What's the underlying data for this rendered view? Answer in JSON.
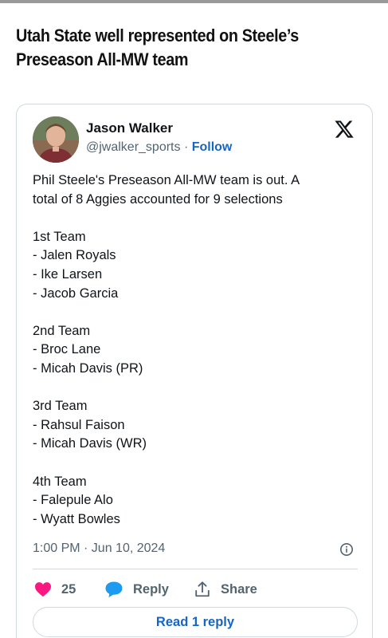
{
  "article": {
    "headline_line1": "Utah State well represented on Steele’s",
    "headline_line2": "Preseason All-MW team"
  },
  "tweet": {
    "author_name": "Jason Walker",
    "author_handle": "@jwalker_sports",
    "separator": " · ",
    "follow_label": "Follow",
    "lines": [
      "Phil Steele's Preseason All-MW team is out. A",
      "total of 8 Aggies accounted for 9 selections",
      "",
      "1st Team",
      "- Jalen Royals",
      "- Ike Larsen",
      "- Jacob Garcia",
      "",
      "2nd Team",
      "- Broc Lane",
      "- Micah Davis (PR)",
      "",
      "3rd Team",
      "- Rahsul Faison",
      "- Micah Davis (WR)",
      "",
      "4th Team",
      "- Falepule Alo",
      "- Wyatt Bowles"
    ],
    "timestamp": "1:00 PM · Jun 10, 2024",
    "like_count": "25",
    "reply_label": "Reply",
    "share_label": "Share",
    "read_replies_label": "Read 1 reply"
  },
  "colors": {
    "like_heart": "#f91880",
    "reply_bubble": "#1d9bf0",
    "link_blue": "#1666c5",
    "muted_text": "#536471"
  },
  "icons": {
    "logo": "x-logo-icon",
    "info": "info-icon",
    "like": "heart-icon",
    "reply": "speech-bubble-icon",
    "share": "share-upload-icon"
  }
}
